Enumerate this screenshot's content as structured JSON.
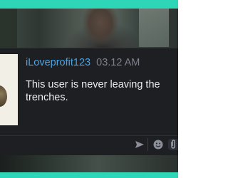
{
  "message": {
    "username": "iLoveprofit123",
    "timestamp": "03.12 AM",
    "text": "This user is never leaving the trenches."
  },
  "composer": {
    "placeholder": ""
  },
  "icons": {
    "send": "send-icon",
    "emoji": "emoji-icon",
    "attach": "paperclip-icon"
  },
  "colors": {
    "frame_accent": "#2ed6b8",
    "username": "#4aa3e3",
    "timestamp": "#7d8189",
    "card_bg": "#1d1f23",
    "message_text": "#ecedef"
  }
}
